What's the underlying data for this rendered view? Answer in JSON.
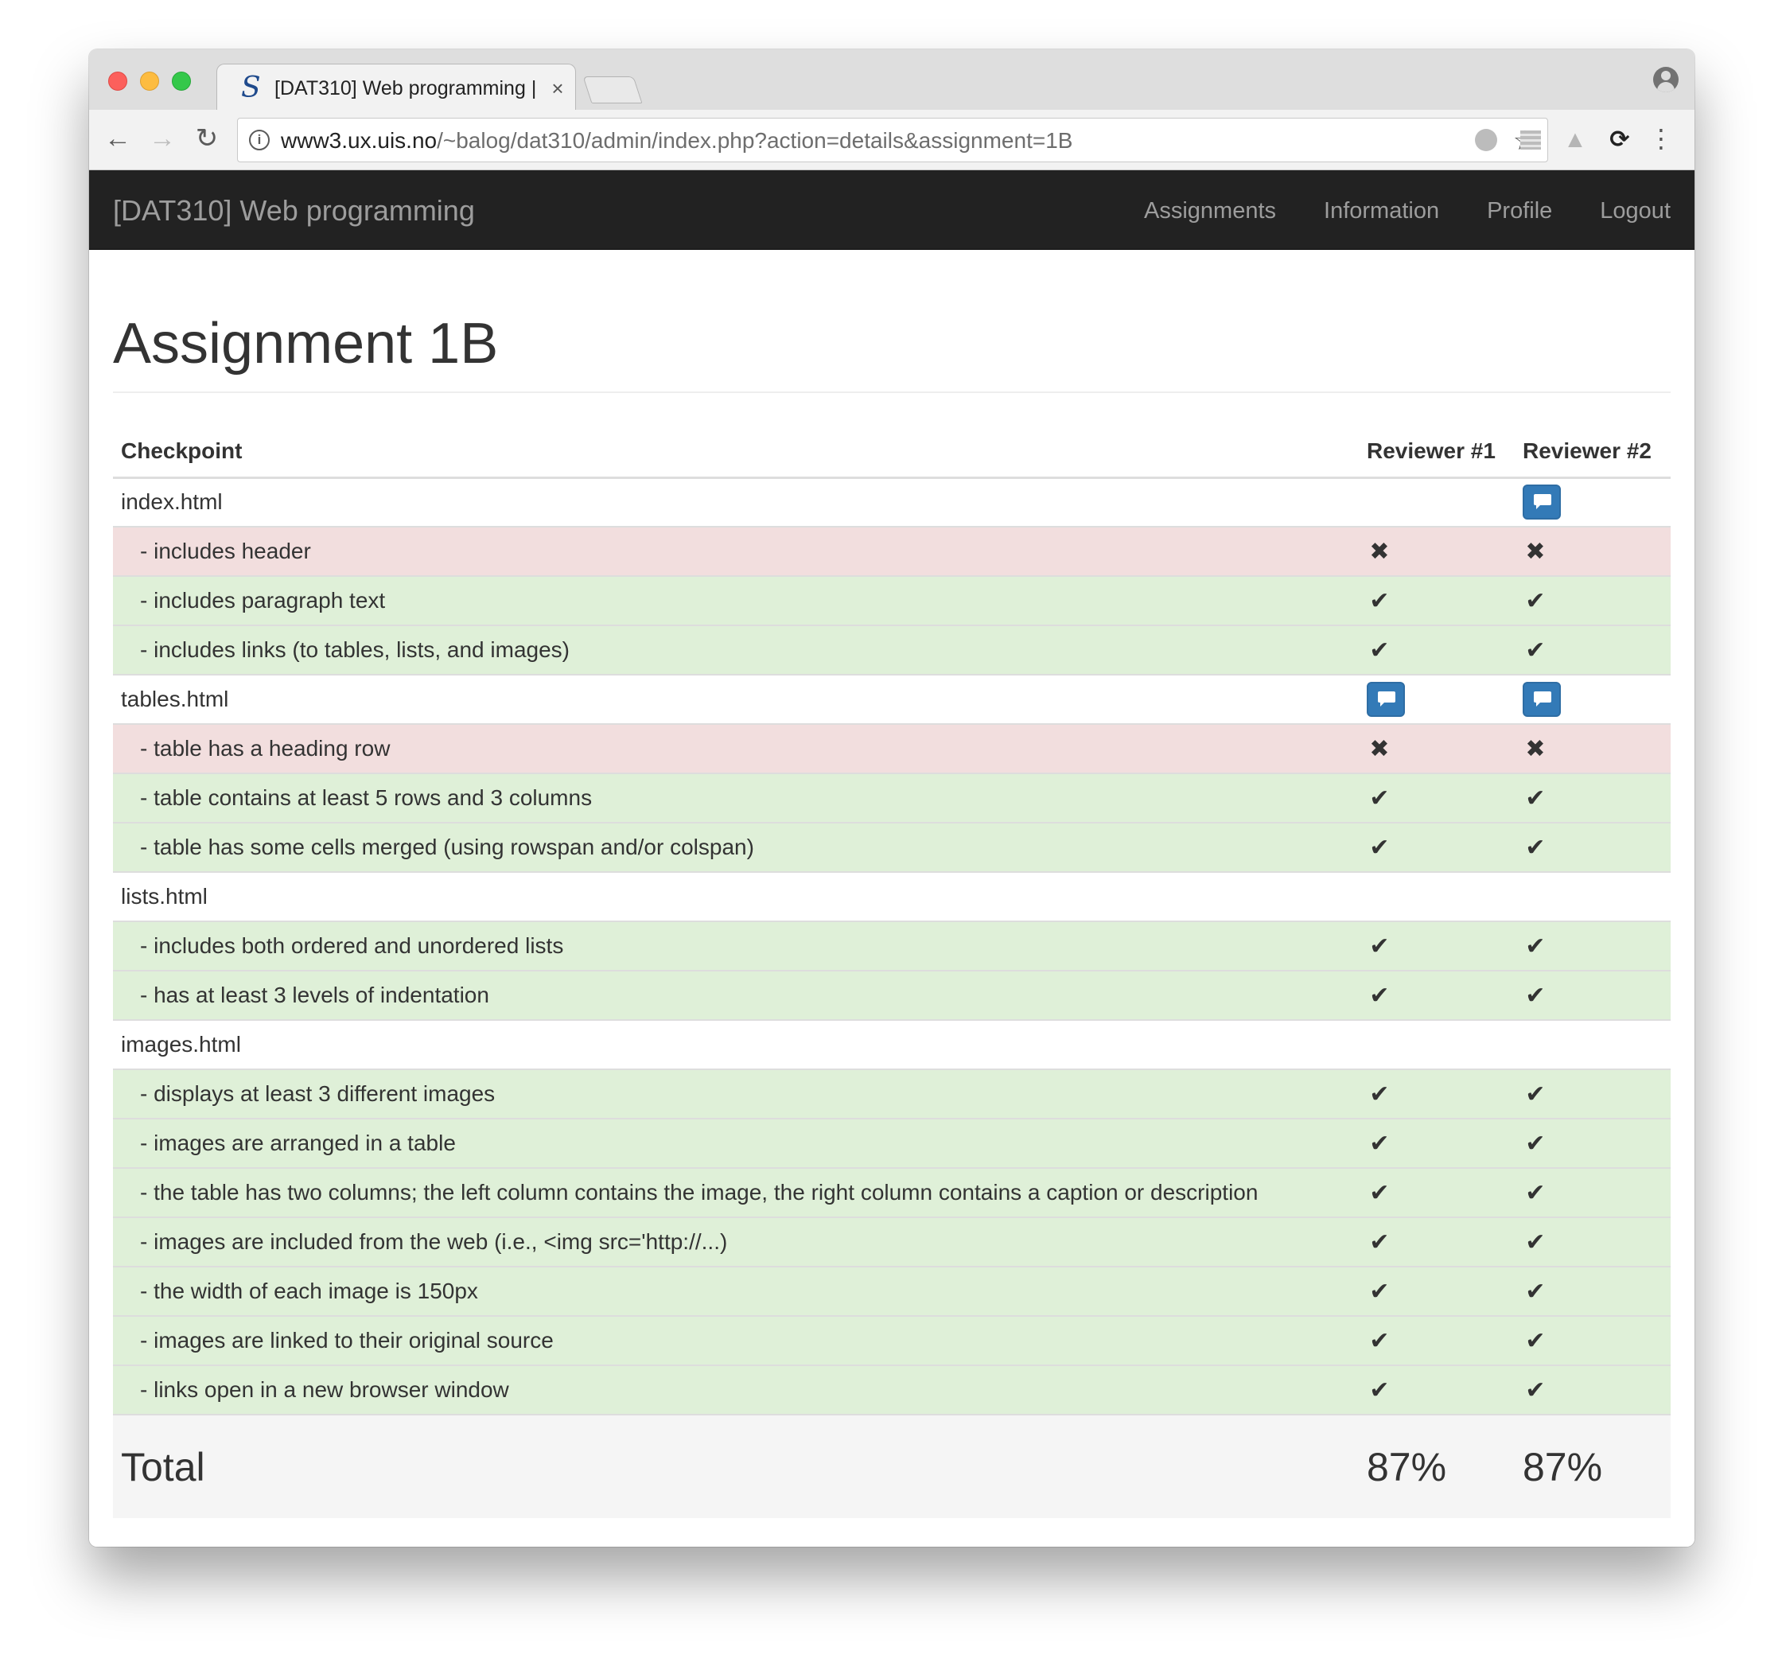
{
  "browser": {
    "tab_title": "[DAT310] Web programming |",
    "tab_close": "×",
    "favicon": "S",
    "url_host": "www3.ux.uis.no",
    "url_path": "/~balog/dat310/admin/index.php?action=details&assignment=1B",
    "back": "←",
    "forward": "→",
    "reload": "↻",
    "star": "☆",
    "ext_drive": "▲",
    "ext_sync": "⟳",
    "menu": "⋮",
    "info": "i"
  },
  "navbar": {
    "brand": "[DAT310] Web programming",
    "links": [
      "Assignments",
      "Information",
      "Profile",
      "Logout"
    ]
  },
  "page": {
    "title": "Assignment 1B"
  },
  "table": {
    "headers": [
      "Checkpoint",
      "Reviewer #1",
      "Reviewer #2"
    ],
    "icons": {
      "check": "✔",
      "cross": "✖",
      "comment": "comment-icon"
    },
    "rows": [
      {
        "type": "file",
        "label": "index.html",
        "r1": "",
        "r2": "comment"
      },
      {
        "type": "bad",
        "label": "- includes header",
        "r1": "cross",
        "r2": "cross"
      },
      {
        "type": "good",
        "label": "- includes paragraph text",
        "r1": "check",
        "r2": "check"
      },
      {
        "type": "good",
        "label": "- includes links (to tables, lists, and images)",
        "r1": "check",
        "r2": "check"
      },
      {
        "type": "file",
        "label": "tables.html",
        "r1": "comment",
        "r2": "comment"
      },
      {
        "type": "bad",
        "label": "- table has a heading row",
        "r1": "cross",
        "r2": "cross"
      },
      {
        "type": "good",
        "label": "- table contains at least 5 rows and 3 columns",
        "r1": "check",
        "r2": "check"
      },
      {
        "type": "good",
        "label": "- table has some cells merged (using rowspan and/or colspan)",
        "r1": "check",
        "r2": "check"
      },
      {
        "type": "file",
        "label": "lists.html",
        "r1": "",
        "r2": ""
      },
      {
        "type": "good",
        "label": "- includes both ordered and unordered lists",
        "r1": "check",
        "r2": "check"
      },
      {
        "type": "good",
        "label": "- has at least 3 levels of indentation",
        "r1": "check",
        "r2": "check"
      },
      {
        "type": "file",
        "label": "images.html",
        "r1": "",
        "r2": ""
      },
      {
        "type": "good",
        "label": "- displays at least 3 different images",
        "r1": "check",
        "r2": "check"
      },
      {
        "type": "good",
        "label": "- images are arranged in a table",
        "r1": "check",
        "r2": "check"
      },
      {
        "type": "good",
        "label": "- the table has two columns; the left column contains the image, the right column contains a caption or description",
        "r1": "check",
        "r2": "check"
      },
      {
        "type": "good",
        "label": "- images are included from the web (i.e., <img src='http://...)",
        "r1": "check",
        "r2": "check"
      },
      {
        "type": "good",
        "label": "- the width of each image is 150px",
        "r1": "check",
        "r2": "check"
      },
      {
        "type": "good",
        "label": "- images are linked to their original source",
        "r1": "check",
        "r2": "check"
      },
      {
        "type": "good",
        "label": "- links open in a new browser window",
        "r1": "check",
        "r2": "check"
      }
    ],
    "total": {
      "label": "Total",
      "r1": "87%",
      "r2": "87%"
    }
  }
}
